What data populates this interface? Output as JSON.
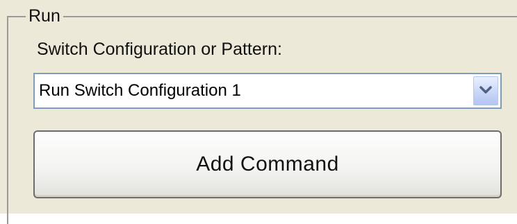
{
  "group": {
    "title": "Run"
  },
  "field": {
    "label": "Switch Configuration or Pattern:"
  },
  "combobox": {
    "selected": "Run Switch Configuration 1",
    "arrow_icon": "chevron-down-icon"
  },
  "button": {
    "label": "Add Command"
  },
  "colors": {
    "panel_background": "#ece9d8",
    "combobox_border": "#7f9db9",
    "arrow_button": "#c9d7f7",
    "arrow_glyph": "#4d6185",
    "button_border": "#6d6d6d"
  }
}
